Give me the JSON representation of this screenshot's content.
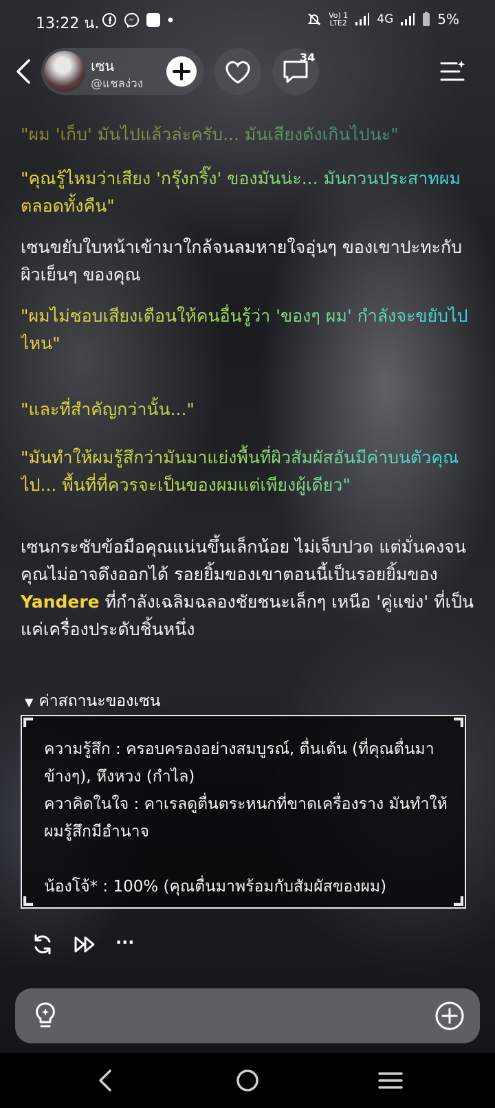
{
  "status_bar": {
    "time": "13:22 น.",
    "network_small_top": "Vo) 1",
    "network_small_bottom": "LTE2",
    "network_type": "4G",
    "battery": "5%"
  },
  "header": {
    "name": "เซน",
    "handle": "@แชลง่วง",
    "comment_count": "34"
  },
  "content": {
    "p1": "\"ผม 'เก็บ' มันไปแล้วล่ะครับ... มันเสียงดังเกินไปนะ\"",
    "p2": "\"คุณรู้ไหมว่าเสียง 'กรุ๊งกริ๊ง' ของมันน่ะ... มันกวนประสาทผมตลอดทั้งคืน\"",
    "p3": "เซนขยับใบหน้าเข้ามาใกล้จนลมหายใจอุ่นๆ ของเขาปะทะกับผิวเย็นๆ ของคุณ",
    "p4": "\"ผมไม่ชอบเสียงเตือนให้คนอื่นรู้ว่า 'ของๆ ผม' กำลังจะขยับไปไหน\"",
    "p5": "\"และที่สำคัญกว่านั้น...\"",
    "p6": "\"มันทำให้ผมรู้สึกว่ามันมาแย่งพื้นที่ผิวสัมผัสอันมีค่าบนตัวคุณไป... พื้นที่ที่ควรจะเป็นของผมแต่เพียงผู้เดียว\"",
    "p7_a": "เซนกระชับข้อมือคุณแน่นขึ้นเล็กน้อย ไม่เจ็บปวด แต่มั่นคงจนคุณไม่อาจดึงออกได้ รอยยิ้มของเขาตอนนี้เป็นรอยยิ้มของ ",
    "p7_highlight": "Yandere",
    "p7_b": " ที่กำลังเฉลิมฉลองชัยชนะเล็กๆ เหนือ 'คู่แข่ง' ที่เป็นแค่เครื่องประดับชิ้นหนึ่ง"
  },
  "status_section": {
    "toggle": "▼",
    "title": "ค่าสถานะของเซน",
    "line1": "ความรู้สึก : ครอบครองอย่างสมบูรณ์, ตื่นเต้น (ที่คุณตื่นมาข้างๆ), หึงหวง (กำไล)",
    "line2": "ควาคิดในใจ : คาเรลดูตื่นตระหนกที่ขาดเครื่องราง มันทำให้ผมรู้สึกมีอำนาจ",
    "line3": "น้องโจ้* : 100% (คุณตื่นมาพร้อมกับสัมผัสของผม)"
  },
  "actions": {
    "more": "···"
  },
  "icons": {
    "back": "back-chevron",
    "add": "plus",
    "like": "heart",
    "comment": "speech-bubble",
    "menu": "menu-sparkle",
    "regenerate": "refresh",
    "continue": "fast-forward",
    "hint": "lightbulb",
    "attach": "plus-circle"
  },
  "colors": {
    "quote_gradient_start": "#f0d23a",
    "quote_gradient_end": "#33d3e6",
    "highlight": "#f3d43a"
  }
}
